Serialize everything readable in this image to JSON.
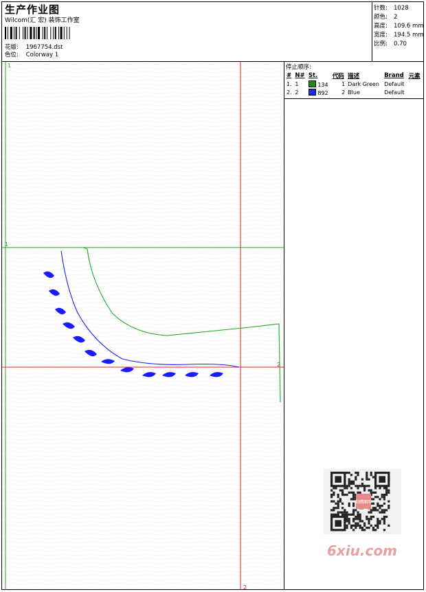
{
  "header": {
    "title": "生产作业图",
    "subtitle": "Wilcom(汇 宏) 装饰工作室",
    "fields": [
      {
        "key": "花版:",
        "value": "1967754.dst"
      },
      {
        "key": "色位:",
        "value": "Colorway 1"
      }
    ]
  },
  "stats": [
    {
      "key": "针数:",
      "value": "1028"
    },
    {
      "key": "颜色:",
      "value": "2"
    },
    {
      "key": "高度:",
      "value": "109.6 mm"
    },
    {
      "key": "宽度:",
      "value": "194.5 mm"
    },
    {
      "key": "比例:",
      "value": "0.70"
    }
  ],
  "stops": {
    "title": "停止顺序:",
    "columns": [
      "#",
      "N#",
      "St.",
      "代码",
      "描述",
      "Brand",
      "元素"
    ],
    "rows": [
      {
        "num": "1.",
        "n": "1",
        "color": "#1a8a1a",
        "st": "134",
        "code": "1",
        "desc": "Dark Green",
        "brand": "Default"
      },
      {
        "num": "2.",
        "n": "2",
        "color": "#1a2ee0",
        "st": "892",
        "code": "2",
        "desc": "Blue",
        "brand": "Default"
      }
    ]
  },
  "design": {
    "guide_labels": {
      "green_v_top": "1",
      "green_h": "1",
      "red_h": "2",
      "red_v_bottom": "2"
    }
  },
  "watermark": {
    "text": "6xiu.com",
    "qr_label": "刻绣图库"
  },
  "colors": {
    "green": "#22aa22",
    "red": "#e02020",
    "blue": "#1a1aff"
  }
}
